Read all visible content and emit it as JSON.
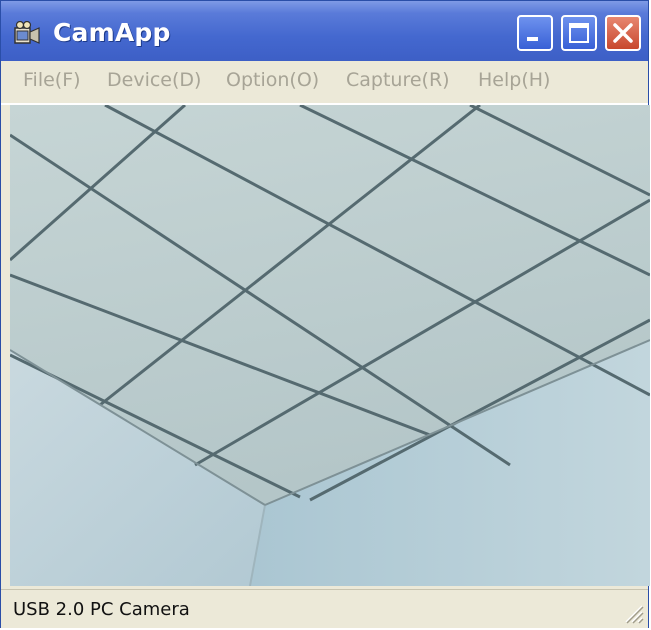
{
  "window": {
    "title": "CamApp",
    "title_bar_color": "#4468cf",
    "close_button_color": "#c8482e"
  },
  "menu": {
    "items": [
      {
        "label": "File(F)"
      },
      {
        "label": "Device(D)"
      },
      {
        "label": "Option(O)"
      },
      {
        "label": "Capture(R)"
      },
      {
        "label": "Help(H)"
      }
    ]
  },
  "video": {
    "content": "camera-preview"
  },
  "status": {
    "text": "USB 2.0 PC Camera"
  }
}
